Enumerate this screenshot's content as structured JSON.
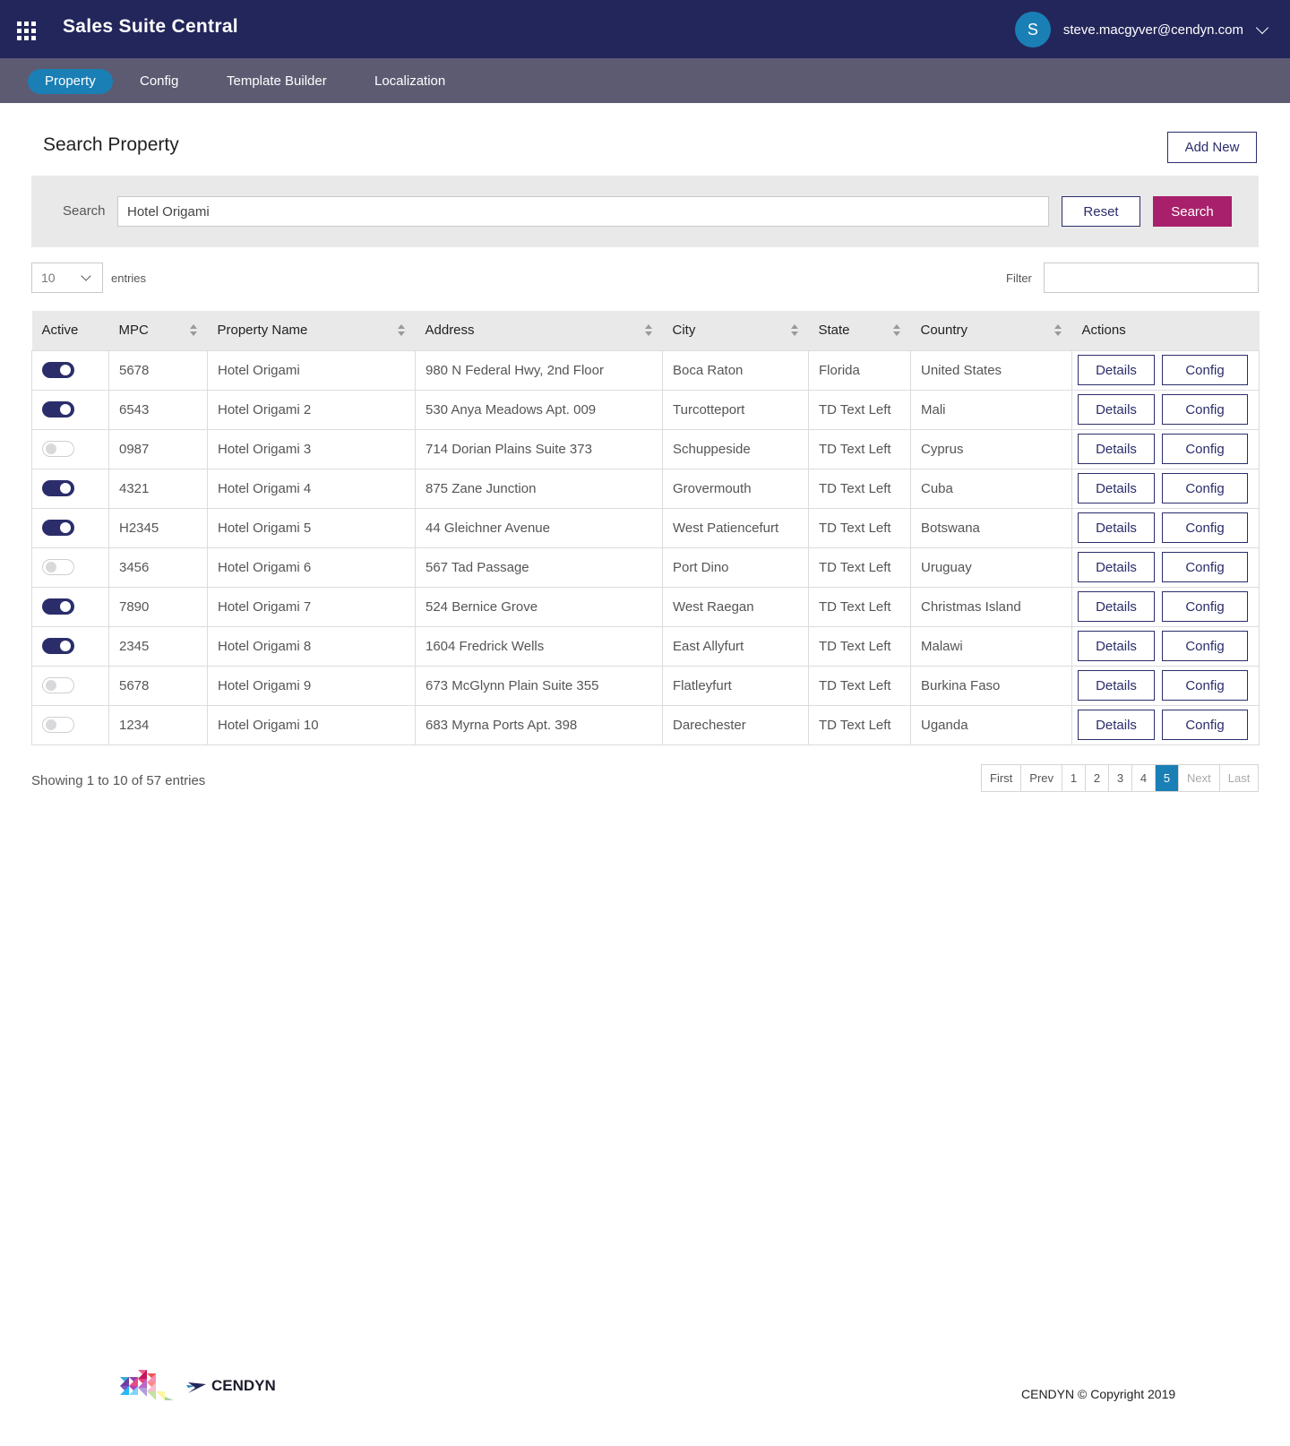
{
  "header": {
    "app_title": "Sales Suite Central",
    "apps_icon": "grid-icon",
    "avatar_initial": "S",
    "user_email": "steve.macgyver@cendyn.com"
  },
  "nav": {
    "tabs": [
      {
        "label": "Property",
        "active": true
      },
      {
        "label": "Config",
        "active": false
      },
      {
        "label": "Template Builder",
        "active": false
      },
      {
        "label": "Localization",
        "active": false
      }
    ]
  },
  "page": {
    "title": "Search Property",
    "add_new_label": "Add New"
  },
  "search": {
    "label": "Search",
    "value": "Hotel Origami",
    "reset_label": "Reset",
    "search_label": "Search"
  },
  "entries": {
    "selected": "10",
    "label": "entries",
    "filter_label": "Filter",
    "filter_value": ""
  },
  "table": {
    "columns": [
      "Active",
      "MPC",
      "Property Name",
      "Address",
      "City",
      "State",
      "Country",
      "Actions"
    ],
    "details_label": "Details",
    "config_label": "Config",
    "rows": [
      {
        "active": true,
        "mpc": "5678",
        "name": "Hotel Origami",
        "address": "980 N Federal Hwy, 2nd Floor",
        "city": "Boca Raton",
        "state": "Florida",
        "country": "United States"
      },
      {
        "active": true,
        "mpc": "6543",
        "name": "Hotel Origami 2",
        "address": "530 Anya Meadows Apt. 009",
        "city": "Turcotteport",
        "state": "TD Text Left",
        "country": "Mali"
      },
      {
        "active": false,
        "mpc": "0987",
        "name": "Hotel Origami 3",
        "address": "714 Dorian Plains Suite 373",
        "city": "Schuppeside",
        "state": "TD Text Left",
        "country": "Cyprus"
      },
      {
        "active": true,
        "mpc": "4321",
        "name": "Hotel Origami 4",
        "address": "875 Zane Junction",
        "city": "Grovermouth",
        "state": "TD Text Left",
        "country": "Cuba"
      },
      {
        "active": true,
        "mpc": "H2345",
        "name": "Hotel Origami 5",
        "address": "44 Gleichner Avenue",
        "city": "West Patiencefurt",
        "state": "TD Text Left",
        "country": "Botswana"
      },
      {
        "active": false,
        "mpc": "3456",
        "name": "Hotel Origami 6",
        "address": "567 Tad Passage",
        "city": "Port Dino",
        "state": "TD Text Left",
        "country": "Uruguay"
      },
      {
        "active": true,
        "mpc": "7890",
        "name": "Hotel Origami 7",
        "address": "524 Bernice Grove",
        "city": "West Raegan",
        "state": "TD Text Left",
        "country": "Christmas Island"
      },
      {
        "active": true,
        "mpc": "2345",
        "name": "Hotel Origami 8",
        "address": "1604 Fredrick Wells",
        "city": "East Allyfurt",
        "state": "TD Text Left",
        "country": "Malawi"
      },
      {
        "active": false,
        "mpc": "5678",
        "name": "Hotel Origami 9",
        "address": "673 McGlynn Plain Suite 355",
        "city": "Flatleyfurt",
        "state": "TD Text Left",
        "country": "Burkina Faso"
      },
      {
        "active": false,
        "mpc": "1234",
        "name": "Hotel Origami 10",
        "address": "683 Myrna Ports Apt. 398",
        "city": "Darechester",
        "state": "TD Text Left",
        "country": "Uganda"
      }
    ]
  },
  "pagination": {
    "summary": "Showing 1 to 10 of 57 entries",
    "first": "First",
    "prev": "Prev",
    "pages": [
      "1",
      "2",
      "3",
      "4",
      "5"
    ],
    "current": "5",
    "next": "Next",
    "last": "Last"
  },
  "footer": {
    "logo_text": "CENDYN",
    "copyright": "CENDYN © Copyright 2019"
  },
  "colors": {
    "header_bg": "#23265a",
    "nav_bg": "#5d5b72",
    "accent_blue": "#1a7fb5",
    "primary_button": "#a8206b",
    "toggle_on": "#2b2d6b"
  }
}
